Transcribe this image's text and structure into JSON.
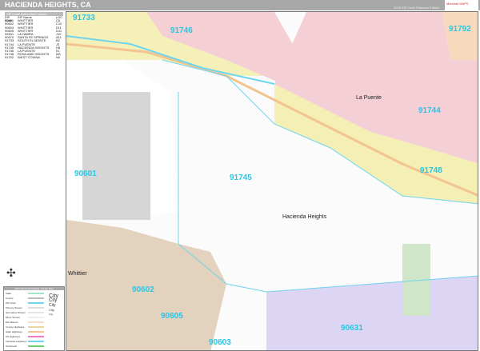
{
  "header": {
    "title": "HACIENDA HEIGHTS, CA",
    "edition": "2023 ZIP Code Premium Edition",
    "logo": "Marshall MAPS"
  },
  "zip_index": {
    "title": "ZIP Code Index/Grid Locator",
    "columns": [
      "ZIP Code",
      "ZIP Name",
      "LOC"
    ],
    "rows": [
      [
        "90601",
        "WHITTIER",
        "C6"
      ],
      [
        "90602",
        "WHITTIER",
        "C10"
      ],
      [
        "90603",
        "WHITTIER",
        "E11"
      ],
      [
        "90605",
        "WHITTIER",
        "D11"
      ],
      [
        "90631",
        "LA HABRA",
        "J10"
      ],
      [
        "90670",
        "SANTA FE SPRINGS",
        "A11"
      ],
      [
        "91733",
        "SOUTH EL MONTE",
        "B2"
      ],
      [
        "91744",
        "LA PUENTE",
        "J3"
      ],
      [
        "91745",
        "HACIENDA HEIGHTS",
        "H8"
      ],
      [
        "91746",
        "LA PUENTE",
        "E1"
      ],
      [
        "91748",
        "ROWLAND HEIGHTS",
        "M8"
      ],
      [
        "91792",
        "WEST COVINA",
        "N0"
      ]
    ]
  },
  "legend": {
    "title": "2023 Hacienda Heights, CA Zip Map",
    "items": [
      "State",
      "County",
      "ZIP Code",
      "Primary Streets",
      "Secondary Streets",
      "Minor Streets",
      "Exit Ramps",
      "County Highways",
      "State Highways",
      "US Highways",
      "Interstate Highways",
      "Toll Roads"
    ],
    "city_labels": [
      "City",
      "City",
      "City",
      "City",
      "City"
    ]
  },
  "map": {
    "zips": [
      "91733",
      "91746",
      "91792",
      "91744",
      "91745",
      "91748",
      "90601",
      "90602",
      "90605",
      "90603",
      "90631"
    ],
    "places": [
      "La Puente",
      "Hacienda Heights",
      "Whittier"
    ]
  }
}
